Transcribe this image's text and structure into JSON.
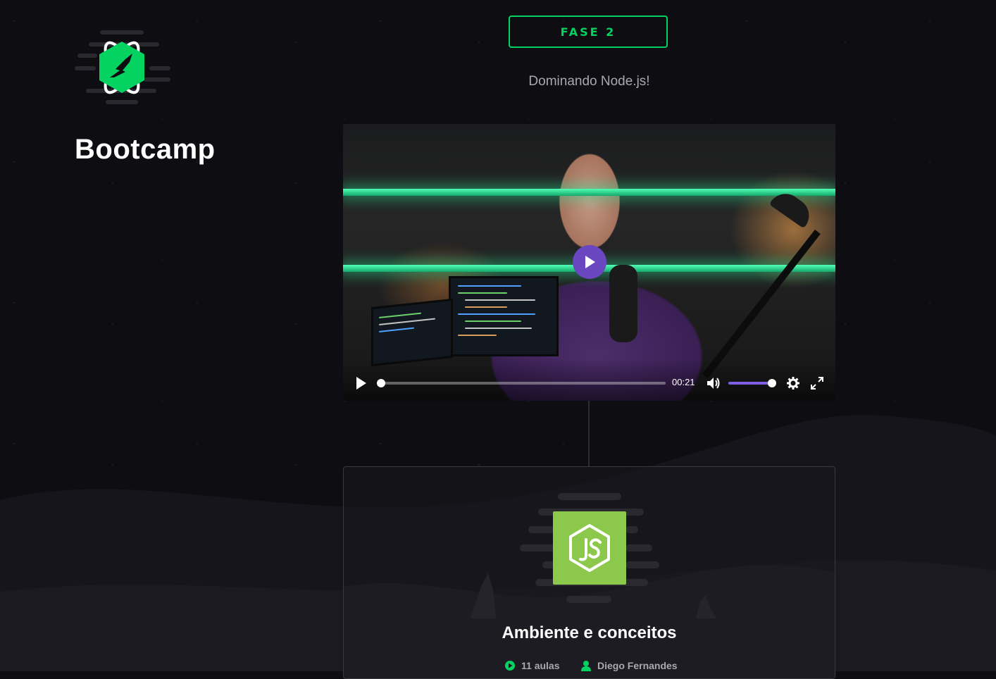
{
  "brand": {
    "name": "Bootcamp"
  },
  "phase": {
    "label": "FASE 2",
    "subtitle": "Dominando Node.js!"
  },
  "video": {
    "current_time": "00:21",
    "progress": 0.0,
    "volume": 1.0,
    "accent_color": "#7f5fe6"
  },
  "module": {
    "title": "Ambiente e conceitos",
    "lessons": "11 aulas",
    "author": "Diego Fernandes",
    "icon": "nodejs-icon",
    "icon_color": "#8cc84b"
  },
  "colors": {
    "brand_green": "#04d361",
    "background": "#0e0d11"
  }
}
